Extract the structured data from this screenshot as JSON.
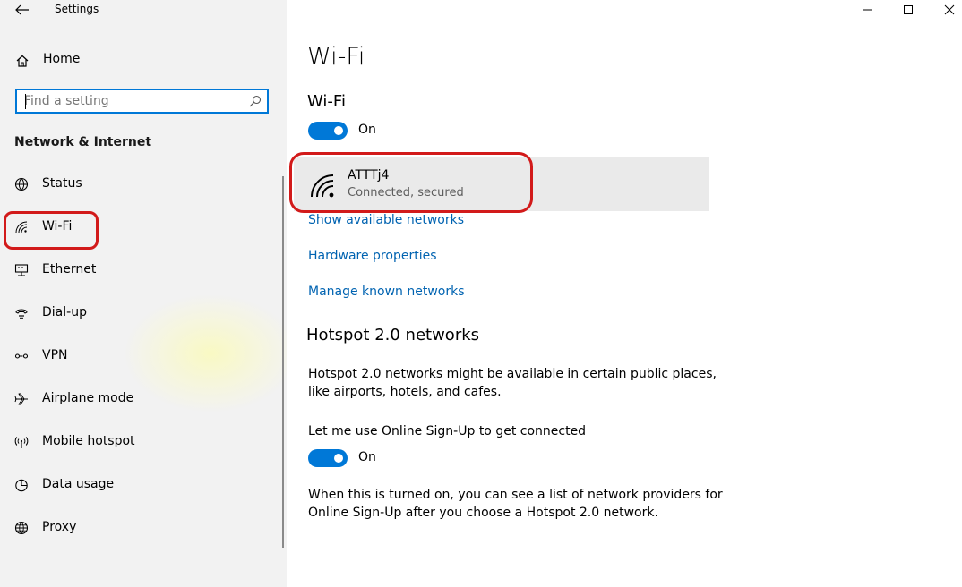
{
  "window": {
    "title": "Settings",
    "controls": [
      "minimize-icon",
      "maximize-icon",
      "close-icon"
    ]
  },
  "sidebar": {
    "home_label": "Home",
    "search": {
      "placeholder": "Find a setting",
      "value": ""
    },
    "section_title": "Network & Internet",
    "items": [
      {
        "label": "Status",
        "icon": "globe-status-icon"
      },
      {
        "label": "Wi-Fi",
        "icon": "wifi-icon",
        "selected": true
      },
      {
        "label": "Ethernet",
        "icon": "ethernet-icon"
      },
      {
        "label": "Dial-up",
        "icon": "dialup-icon"
      },
      {
        "label": "VPN",
        "icon": "vpn-icon"
      },
      {
        "label": "Airplane mode",
        "icon": "airplane-icon"
      },
      {
        "label": "Mobile hotspot",
        "icon": "hotspot-icon"
      },
      {
        "label": "Data usage",
        "icon": "data-usage-icon"
      },
      {
        "label": "Proxy",
        "icon": "proxy-globe-icon"
      }
    ]
  },
  "main": {
    "page_title": "Wi-Fi",
    "wifi_section": {
      "title": "Wi-Fi",
      "toggle_state": "On",
      "toggle_on": true
    },
    "network": {
      "name": "ATTTj4",
      "status": "Connected, secured"
    },
    "links": {
      "show_available": "Show available networks",
      "hardware": "Hardware properties",
      "manage_known": "Manage known networks"
    },
    "hotspot": {
      "title": "Hotspot 2.0 networks",
      "description_line1": "Hotspot 2.0 networks might be available in certain public places,",
      "description_line2": "like airports, hotels, and cafes.",
      "signup_label": "Let me use Online Sign-Up to get connected",
      "toggle_state": "On",
      "toggle_on": true,
      "note_line1": "When this is turned on, you can see a list of network providers for",
      "note_line2": "Online Sign-Up after you choose a Hotspot 2.0 network."
    }
  },
  "colors": {
    "accent": "#0078d7",
    "link": "#0063b1",
    "annotation": "#d21a1a",
    "sidebar_bg": "#f2f2f2"
  }
}
